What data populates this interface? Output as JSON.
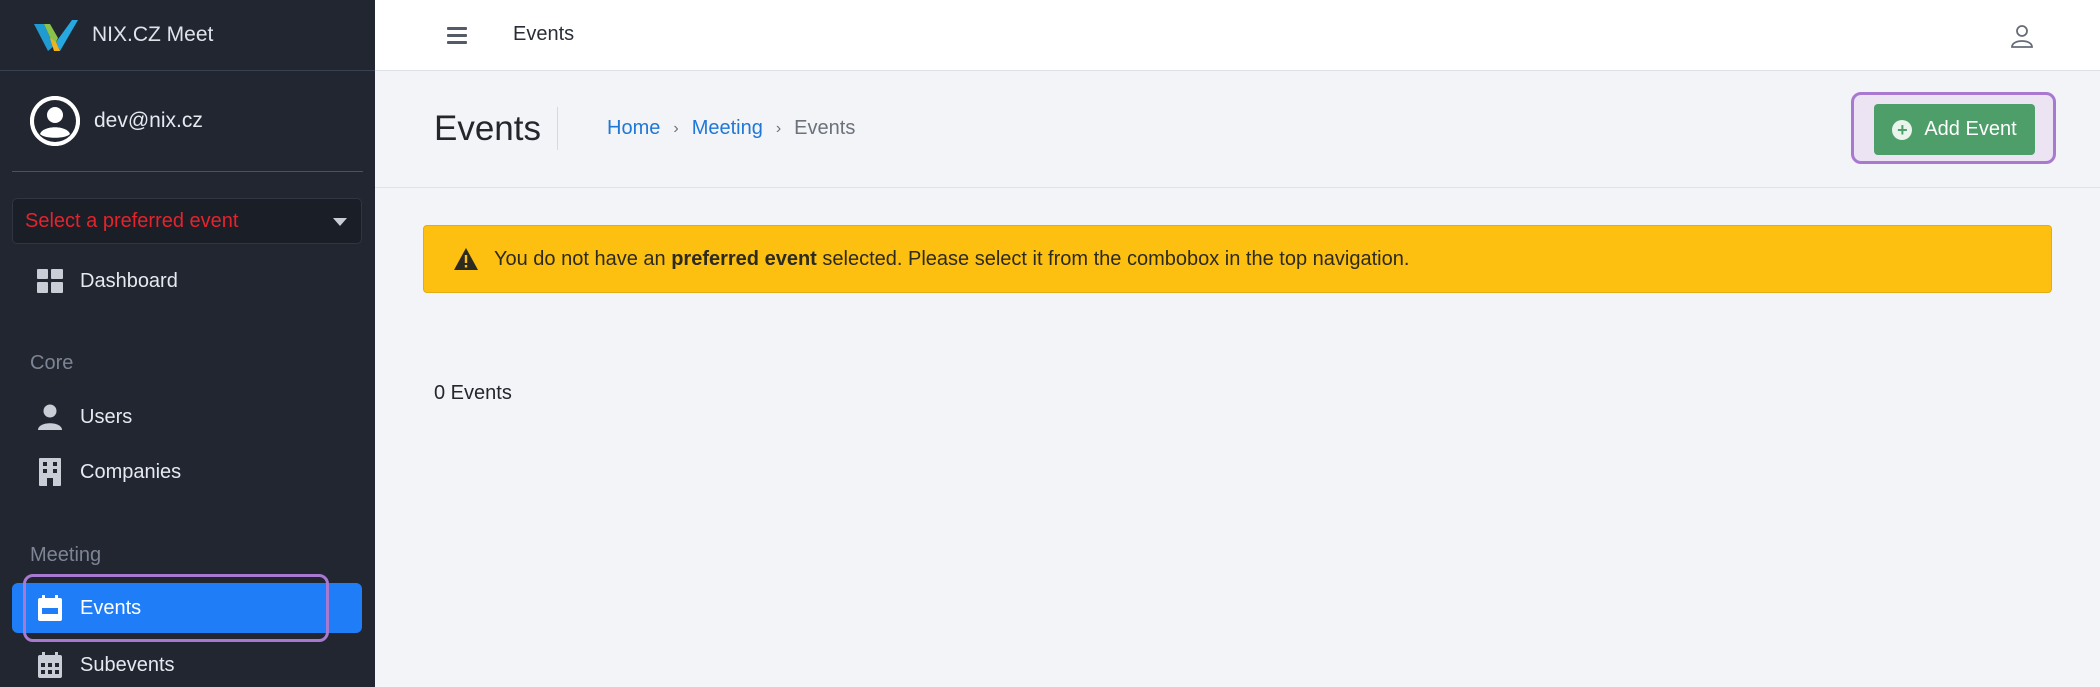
{
  "app": {
    "brand_name": "NIX.CZ Meet",
    "user_email": "dev@nix.cz"
  },
  "event_select": {
    "placeholder": "Select a preferred event"
  },
  "sidebar": {
    "dashboard_label": "Dashboard",
    "core_heading": "Core",
    "users_label": "Users",
    "companies_label": "Companies",
    "meeting_heading": "Meeting",
    "events_label": "Events",
    "subevents_label": "Subevents",
    "active_item": "Events"
  },
  "topbar": {
    "title": "Events"
  },
  "header": {
    "title": "Events",
    "breadcrumb": {
      "home": "Home",
      "meeting": "Meeting",
      "current": "Events"
    },
    "add_button_label": "Add Event"
  },
  "alert": {
    "text_before": "You do not have an ",
    "text_bold": "preferred event",
    "text_after": " selected. Please select it from the combobox in the top navigation."
  },
  "events_count_text": "0 Events",
  "colors": {
    "sidebar_bg": "#212631",
    "active_nav": "#1f7ef7",
    "add_button": "#4e9e6a",
    "alert_bg": "#fdc010",
    "highlight": "#a879d1",
    "select_placeholder": "#e5232c"
  }
}
